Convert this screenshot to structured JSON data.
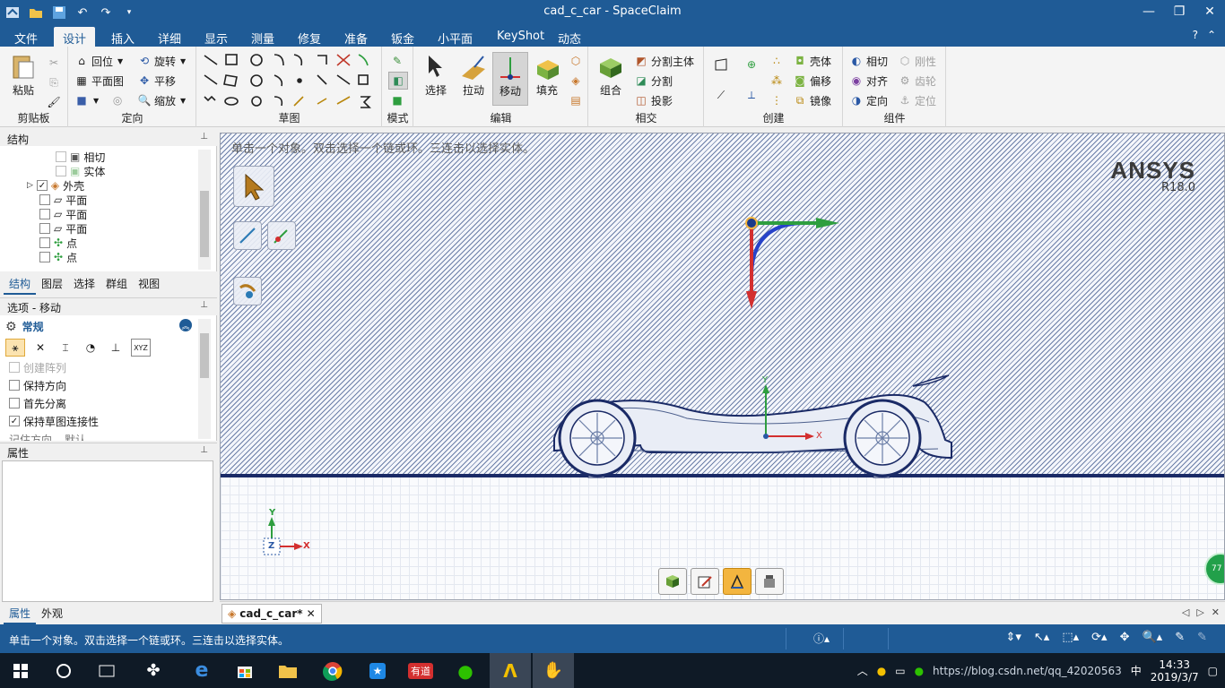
{
  "window": {
    "title": "cad_c_car - SpaceClaim",
    "qat_icons": [
      "app-icon",
      "open-icon",
      "save-icon",
      "undo-icon",
      "redo-icon",
      "customize-icon"
    ]
  },
  "tabs": [
    "文件",
    "设计",
    "插入",
    "详细",
    "显示",
    "测量",
    "修复",
    "准备",
    "钣金",
    "小平面",
    "KeyShot",
    "动态"
  ],
  "active_tab": "设计",
  "ribbon": {
    "clipboard": {
      "label": "剪贴板",
      "paste": "粘贴"
    },
    "orient": {
      "label": "定向",
      "home": "回位",
      "plan": "平面图",
      "rotate": "旋转",
      "pan": "平移",
      "zoom": "缩放"
    },
    "sketch": {
      "label": "草图"
    },
    "mode": {
      "label": "模式"
    },
    "edit": {
      "label": "编辑",
      "select": "选择",
      "pull": "拉动",
      "move": "移动",
      "fill": "填充"
    },
    "intersect": {
      "label": "相交",
      "combine": "组合",
      "split_body": "分割主体",
      "split": "分割",
      "project": "投影"
    },
    "create": {
      "label": "创建",
      "shell": "壳体",
      "offset": "偏移",
      "mirror": "镜像"
    },
    "assembly": {
      "label": "组件",
      "tangent": "相切",
      "align": "对齐",
      "orient": "定向",
      "rigid": "刚性",
      "gear": "齿轮",
      "anchor": "定位"
    }
  },
  "structure_panel": {
    "title": "结构",
    "tree": [
      {
        "label": "相切",
        "checked": false
      },
      {
        "label": "实体",
        "checked": false
      },
      {
        "label": "外壳",
        "checked": true
      },
      {
        "label": "平面",
        "checked": false
      },
      {
        "label": "平面",
        "checked": false
      },
      {
        "label": "平面",
        "checked": false
      },
      {
        "label": "点",
        "checked": false
      },
      {
        "label": "点",
        "checked": false
      }
    ],
    "tabs": [
      "结构",
      "图层",
      "选择",
      "群组",
      "视图"
    ]
  },
  "options_panel": {
    "title": "选项 - 移动",
    "section": "常规",
    "options": [
      {
        "label": "创建阵列",
        "checked": false,
        "disabled": true
      },
      {
        "label": "保持方向",
        "checked": false,
        "disabled": false
      },
      {
        "label": "首先分离",
        "checked": false,
        "disabled": false
      },
      {
        "label": "保持草图连接性",
        "checked": true,
        "disabled": false
      }
    ],
    "partial_row": "记住方向",
    "partial_value": "默认",
    "tool_icons": [
      "move-anchor-icon",
      "move-direction-icon",
      "ruler-icon",
      "clock-icon",
      "dimension-icon",
      "xyz-icon"
    ]
  },
  "properties_panel": {
    "title": "属性",
    "tabs": [
      "属性",
      "外观"
    ]
  },
  "viewport": {
    "hint": "单击一个对象。双击选择一个链或环。三连击以选择实体。",
    "brand": "ANSYS",
    "version": "R18.0",
    "axis_y": "Y",
    "axis_x": "X",
    "axis_z": "Z"
  },
  "document_tab": "cad_c_car*",
  "statusbar": {
    "message": "单击一个对象。双击选择一个链或环。三连击以选择实体。"
  },
  "taskbar": {
    "time": "14:33",
    "date": "2019/3/7",
    "ime": "中",
    "watermark": "https://blog.csdn.net/qq_42020563"
  },
  "colors": {
    "accent": "#1f5b96",
    "hatch": "#6c7fa8",
    "axis_x": "#d32f2f",
    "axis_y": "#2e9e3f",
    "rot": "#2743c9"
  }
}
